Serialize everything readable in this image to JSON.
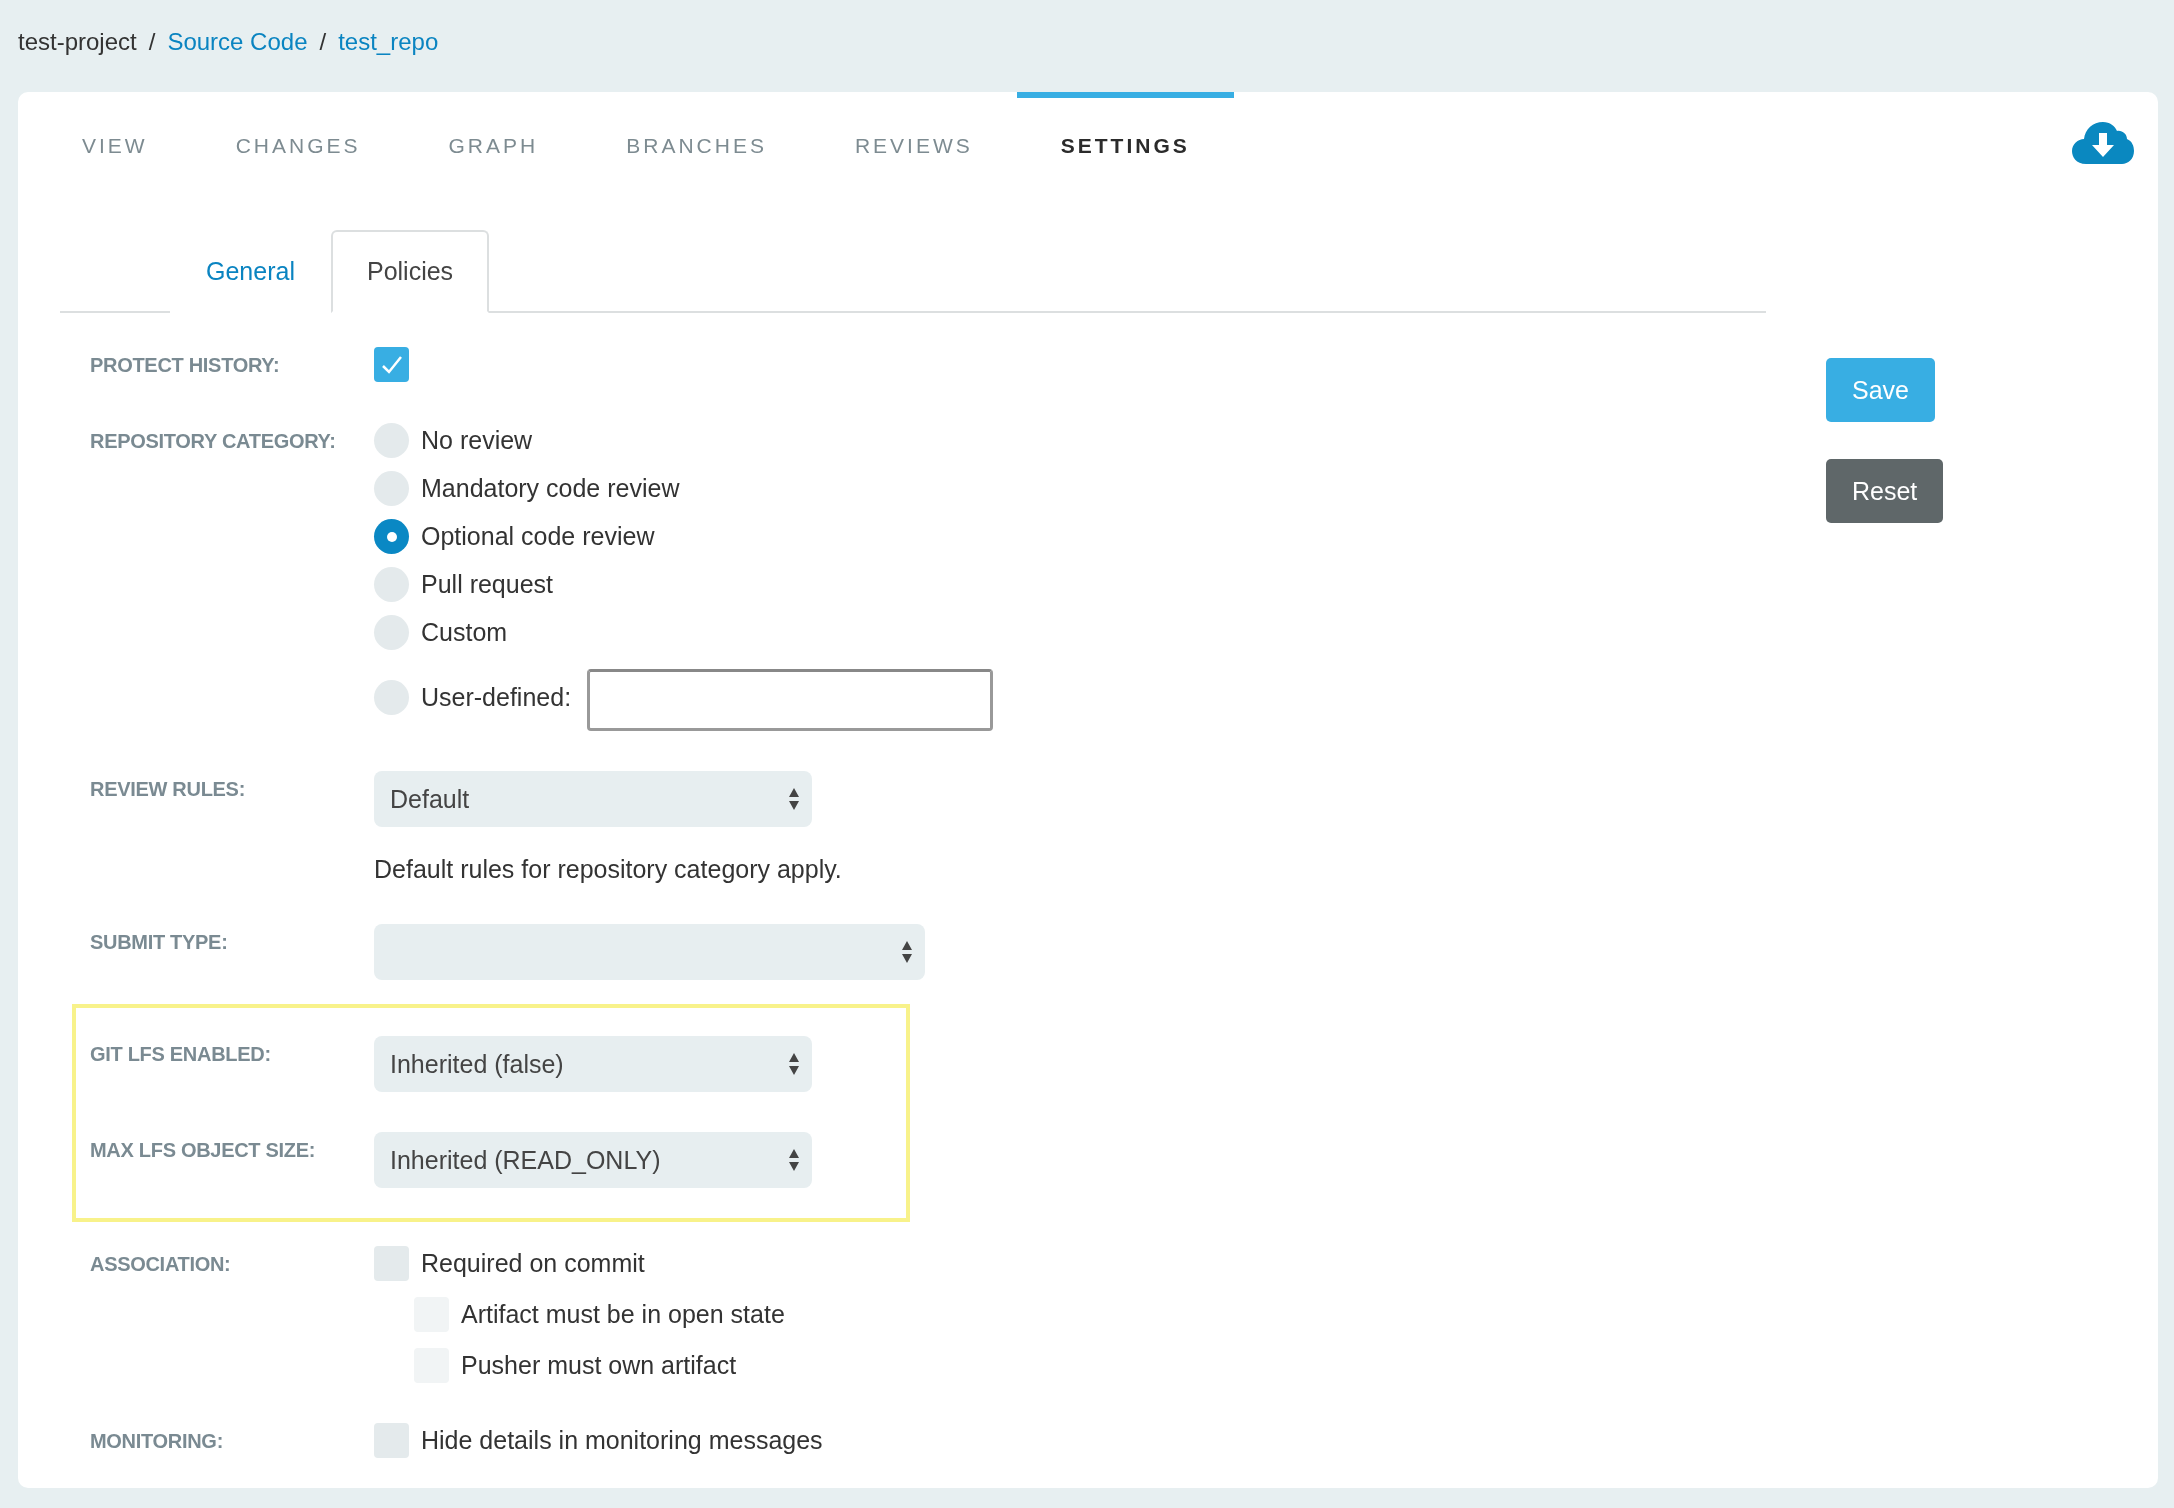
{
  "breadcrumb": [
    {
      "label": "test-project",
      "link": false
    },
    {
      "label": "Source Code",
      "link": true,
      "separator": "/"
    },
    {
      "label": "test_repo",
      "link": true,
      "separator": "/"
    }
  ],
  "tabs": [
    {
      "label": "VIEW",
      "selected": false
    },
    {
      "label": "CHANGES",
      "selected": false
    },
    {
      "label": "GRAPH",
      "selected": false
    },
    {
      "label": "BRANCHES",
      "selected": false
    },
    {
      "label": "REVIEWS",
      "selected": false
    },
    {
      "label": "SETTINGS",
      "selected": true
    }
  ],
  "subtabs": [
    {
      "label": "General",
      "selected": false
    },
    {
      "label": "Policies",
      "selected": true
    }
  ],
  "sections": [
    {
      "rows": [
        {
          "label": "PROTECT HISTORY:",
          "kind": "checks",
          "options": [
            {
              "checked": true
            }
          ]
        },
        {
          "label": "REPOSITORY CATEGORY:",
          "kind": "radios",
          "options": [
            {
              "label": "No review",
              "selected": false
            },
            {
              "label": "Mandatory code review",
              "selected": false
            },
            {
              "label": "Optional code review",
              "selected": true
            },
            {
              "label": "Pull request",
              "selected": false
            },
            {
              "label": "Custom",
              "selected": false
            },
            {
              "label": "User-defined:",
              "selected": false,
              "with_field": true
            }
          ]
        },
        {
          "label": "REVIEW RULES:",
          "kind": "select",
          "value": "Default",
          "hint": "Default rules for repository category apply."
        },
        {
          "label": "SUBMIT TYPE:",
          "kind": "select"
        }
      ]
    },
    {
      "highlighted": true,
      "rows": [
        {
          "label": "GIT LFS ENABLED:",
          "kind": "select",
          "value": "Inherited (false)"
        },
        {
          "label": "MAX LFS OBJECT SIZE:",
          "kind": "select",
          "value": "Inherited (READ_ONLY)"
        }
      ]
    },
    {
      "rows": [
        {
          "label": "ASSOCIATION:",
          "kind": "checks",
          "options": [
            {
              "label": "Required on commit",
              "checked": false,
              "children": [
                {
                  "label": "Artifact must be in open state",
                  "checked": false,
                  "disabled": true
                },
                {
                  "label": "Pusher must own artifact",
                  "checked": false,
                  "disabled": true
                }
              ]
            }
          ]
        },
        {
          "label": "MONITORING:",
          "kind": "checks",
          "options": [
            {
              "label": "Hide details in monitoring messages",
              "checked": false
            }
          ]
        }
      ]
    }
  ],
  "buttons": [
    {
      "label": "Save",
      "kind": "primary"
    },
    {
      "label": "Reset",
      "kind": "secondary"
    }
  ]
}
